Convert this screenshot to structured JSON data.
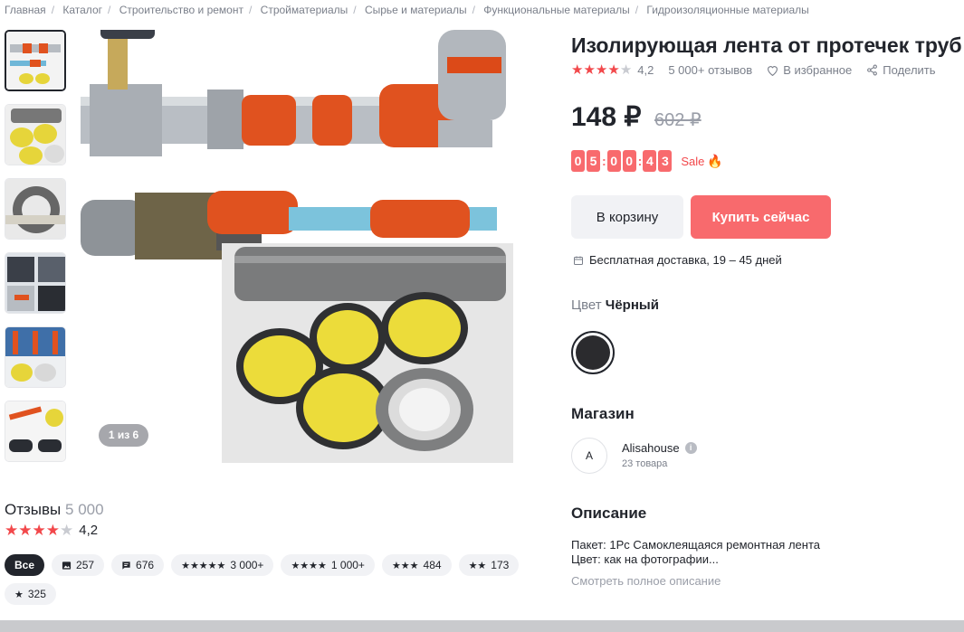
{
  "breadcrumb": [
    "Главная",
    "Каталог",
    "Строительство и ремонт",
    "Стройматериалы",
    "Сырье и материалы",
    "Функциональные материалы",
    "Гидроизоляционные материалы"
  ],
  "product": {
    "title": "Изолирующая лента от протечек труб",
    "rating": "4,2",
    "reviews": "5 000+ отзывов",
    "favorite": "В избранное",
    "share": "Поделить",
    "price": "148 ₽",
    "old_price": "602 ₽",
    "timer_digits": [
      "0",
      "5",
      "0",
      "0",
      "4",
      "3"
    ],
    "sale_label": "Sale",
    "pager": "1 из 6"
  },
  "buttons": {
    "cart": "В корзину",
    "buy": "Купить сейчас"
  },
  "delivery": "Бесплатная доставка, 19 – 45 дней",
  "color": {
    "label": "Цвет",
    "value": "Чёрный"
  },
  "store": {
    "heading": "Магазин",
    "avatar_letter": "A",
    "name": "Alisahouse",
    "count": "23 товара"
  },
  "description": {
    "heading": "Описание",
    "line1": "Пакет: 1Pc Самоклеящаяся ремонтная лента",
    "line2": "Цвет: как на фотографии...",
    "more": "Смотреть полное описание"
  },
  "reviews": {
    "heading": "Отзывы",
    "count": "5 000",
    "rating": "4,2",
    "chips": {
      "all": "Все",
      "photo": "257",
      "comment": "676",
      "five": "3 000+",
      "four": "1 000+",
      "three": "484",
      "two": "173",
      "one": "325"
    }
  },
  "colors": {
    "accent": "#f86a6d",
    "text": "#22252c",
    "muted": "#7a7f8a"
  }
}
